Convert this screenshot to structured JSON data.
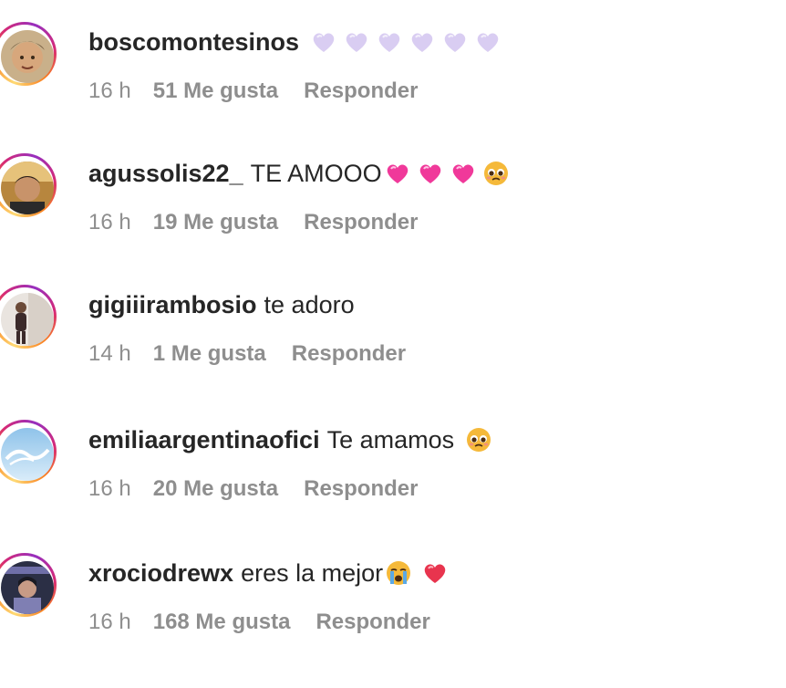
{
  "comments": [
    {
      "username": "boscomontesinos",
      "text": "",
      "emojis": [
        "lavender-heart-icon",
        "lavender-heart-icon",
        "lavender-heart-icon",
        "lavender-heart-icon",
        "lavender-heart-icon",
        "lavender-heart-icon"
      ],
      "time": "16 h",
      "likes": "51 Me gusta",
      "reply": "Responder"
    },
    {
      "username": "agussolis22_",
      "text": "TE AMOOO",
      "emojis": [
        "pink-heart-icon",
        "pink-heart-icon",
        "pink-heart-icon",
        "pleading-face-icon"
      ],
      "time": "16 h",
      "likes": "19 Me gusta",
      "reply": "Responder"
    },
    {
      "username": "gigiiirambosio",
      "text": "te adoro",
      "emojis": [],
      "time": "14 h",
      "likes": "1 Me gusta",
      "reply": "Responder"
    },
    {
      "username": "emiliaargentinaofici",
      "text": "Te amamos",
      "emojis": [
        "pleading-face-icon"
      ],
      "time": "16 h",
      "likes": "20 Me gusta",
      "reply": "Responder"
    },
    {
      "username": "xrociodrewx",
      "text": "eres la mejor",
      "emojis": [
        "crying-face-icon",
        "red-heart-icon"
      ],
      "time": "16 h",
      "likes": "168 Me gusta",
      "reply": "Responder"
    }
  ],
  "colors": {
    "username": "#262626",
    "meta": "#8e8e8e",
    "lavender_heart": "#d9cdf2",
    "pink_heart": "#f0399a",
    "red_heart": "#e8344e",
    "emoji_face": "#f5b93a"
  }
}
